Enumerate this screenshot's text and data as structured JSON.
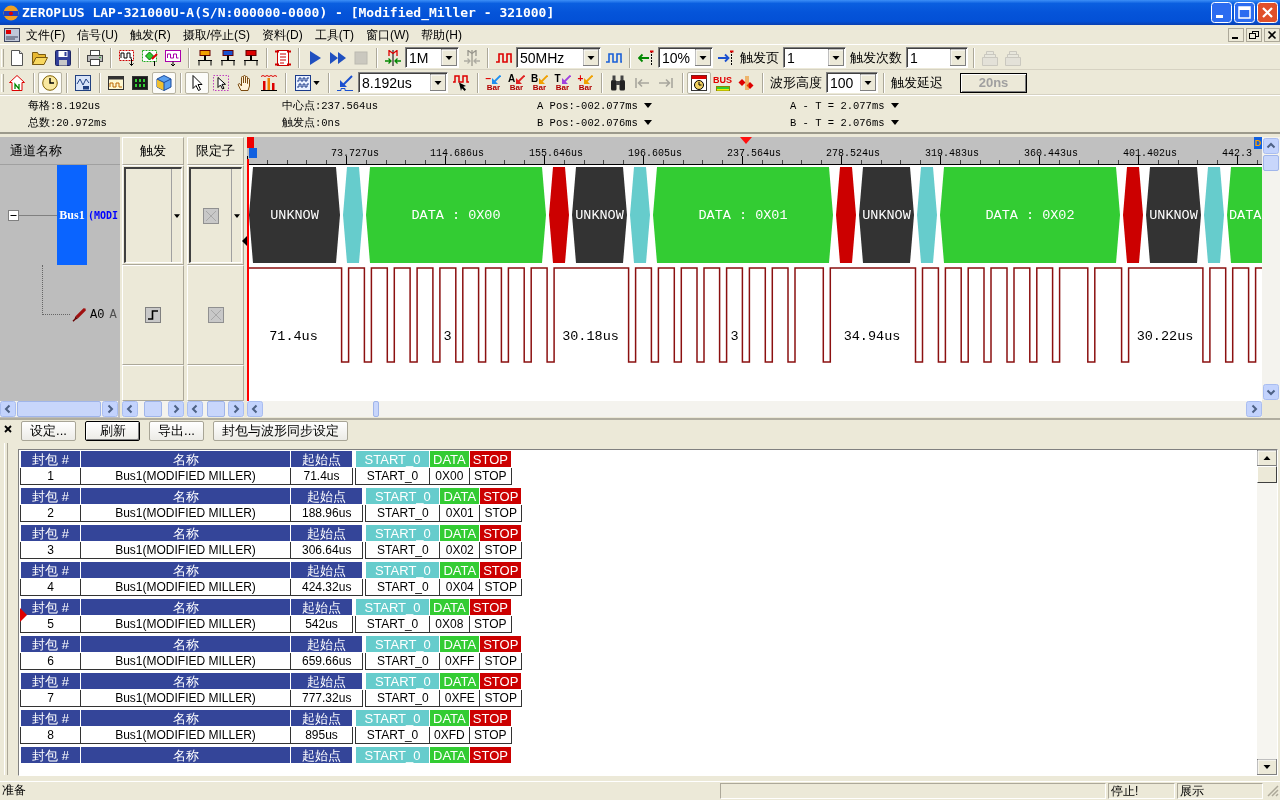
{
  "window": {
    "title": "ZEROPLUS LAP-321000U-A(S/N:000000-0000) - [Modified_Miller - 321000]"
  },
  "menu": [
    {
      "label": "文件(F)"
    },
    {
      "label": "信号(U)"
    },
    {
      "label": "触发(R)"
    },
    {
      "label": "摄取/停止(S)"
    },
    {
      "label": "资料(D)"
    },
    {
      "label": "工具(T)"
    },
    {
      "label": "窗口(W)"
    },
    {
      "label": "帮助(H)"
    }
  ],
  "toolbars": [
    {
      "groups": [
        [
          {
            "kind": "tool",
            "pressed": false,
            "disabled": false
          },
          {
            "kind": "tool",
            "pressed": false,
            "disabled": false
          },
          {
            "kind": "tool",
            "pressed": false,
            "disabled": false
          }
        ],
        [
          {
            "kind": "tool",
            "pressed": false,
            "disabled": false
          }
        ],
        [
          {
            "kind": "tool",
            "pressed": false,
            "disabled": false
          },
          {
            "kind": "tool",
            "pressed": false,
            "disabled": false
          },
          {
            "kind": "tool",
            "pressed": false,
            "disabled": false
          }
        ],
        [
          {
            "kind": "tool",
            "pressed": false,
            "disabled": false
          },
          {
            "kind": "tool",
            "pressed": false,
            "disabled": false
          },
          {
            "kind": "tool",
            "pressed": false,
            "disabled": false
          }
        ],
        [
          {
            "kind": "tool",
            "pressed": false,
            "disabled": false
          }
        ],
        [
          {
            "kind": "tool",
            "pressed": false,
            "disabled": false
          },
          {
            "kind": "tool",
            "pressed": false,
            "disabled": false
          },
          {
            "kind": "tool",
            "pressed": false,
            "disabled": true
          }
        ],
        [
          {
            "kind": "tool",
            "pressed": false,
            "disabled": false
          },
          {
            "kind": "combo",
            "value": "1M"
          },
          {
            "kind": "tool",
            "pressed": false,
            "disabled": true
          }
        ],
        [
          {
            "kind": "tool",
            "pressed": false,
            "disabled": false
          },
          {
            "kind": "combo",
            "value": "50MHz"
          },
          {
            "kind": "tool",
            "pressed": false,
            "disabled": false
          }
        ],
        [
          {
            "kind": "tool",
            "pressed": false,
            "disabled": false
          },
          {
            "kind": "combo",
            "value": "10%"
          },
          {
            "kind": "tool",
            "pressed": false,
            "disabled": false
          },
          {
            "kind": "label",
            "text": "触发页"
          },
          {
            "kind": "combo",
            "value": "1"
          },
          {
            "kind": "label",
            "text": "触发次数"
          },
          {
            "kind": "combo",
            "value": "1"
          }
        ],
        [
          {
            "kind": "tool",
            "pressed": false,
            "disabled": true
          },
          {
            "kind": "tool",
            "pressed": false,
            "disabled": true
          }
        ]
      ]
    },
    {
      "groups": [
        [
          {
            "kind": "tool",
            "pressed": false,
            "disabled": false
          }
        ],
        [
          {
            "kind": "tool",
            "pressed": true,
            "disabled": false
          }
        ],
        [
          {
            "kind": "tool",
            "pressed": false,
            "disabled": false
          }
        ],
        [
          {
            "kind": "tool",
            "pressed": false,
            "disabled": false
          },
          {
            "kind": "tool",
            "pressed": false,
            "disabled": false
          },
          {
            "kind": "tool",
            "pressed": true,
            "disabled": false
          }
        ],
        [
          {
            "kind": "tool",
            "pressed": true,
            "disabled": false
          },
          {
            "kind": "tool",
            "pressed": false,
            "disabled": false
          },
          {
            "kind": "tool",
            "pressed": false,
            "disabled": false
          },
          {
            "kind": "tool",
            "pressed": false,
            "disabled": false
          }
        ],
        [
          {
            "kind": "split-tool",
            "pressed": false,
            "disabled": false
          }
        ],
        [
          {
            "kind": "tool",
            "pressed": false,
            "disabled": false
          },
          {
            "kind": "combo",
            "value": "8.192us"
          },
          {
            "kind": "tool",
            "pressed": false,
            "disabled": false
          }
        ],
        [
          {
            "kind": "sign-tool",
            "glyph": "−",
            "caption": "Bar",
            "color": "#1e8ff0"
          },
          {
            "kind": "letter-tool",
            "glyph": "A",
            "caption": "Bar",
            "color": "#e02020"
          },
          {
            "kind": "letter-tool",
            "glyph": "B",
            "caption": "Bar",
            "color": "#f0a000"
          },
          {
            "kind": "letter-tool",
            "glyph": "T",
            "caption": "Bar",
            "color": "#a040e0"
          },
          {
            "kind": "sign-tool",
            "glyph": "+",
            "caption": "Bar",
            "color": "#f0a000"
          }
        ],
        [
          {
            "kind": "tool",
            "pressed": false,
            "disabled": false
          },
          {
            "kind": "tool",
            "pressed": false,
            "disabled": true
          },
          {
            "kind": "tool",
            "pressed": false,
            "disabled": true
          }
        ],
        [
          {
            "kind": "tool",
            "pressed": true,
            "disabled": false
          },
          {
            "kind": "bus-tool",
            "caption": "BUS"
          },
          {
            "kind": "tool",
            "pressed": false,
            "disabled": false
          }
        ],
        [
          {
            "kind": "label",
            "text": "波形高度"
          },
          {
            "kind": "combo",
            "value": "100"
          }
        ],
        [
          {
            "kind": "label",
            "text": "触发延迟"
          },
          {
            "kind": "button",
            "label": "20ns",
            "disabled": true
          }
        ]
      ]
    }
  ],
  "readouts": {
    "columns": [
      {
        "items": [
          {
            "kind": "text",
            "text": "每格:8.192us"
          },
          {
            "kind": "text",
            "text": "总数:20.972ms"
          }
        ]
      },
      {
        "items": [
          {
            "kind": "text",
            "text": "中心点:237.564us"
          },
          {
            "kind": "text",
            "text": "触发点:0ns"
          }
        ]
      },
      {
        "items": [
          {
            "kind": "menu",
            "text": "A Pos:-002.077ms"
          },
          {
            "kind": "menu",
            "text": "B Pos:-002.076ms"
          }
        ]
      },
      {
        "items": [
          {
            "kind": "menu",
            "text": "A - T = 2.077ms"
          },
          {
            "kind": "menu",
            "text": "B - T = 2.076ms"
          }
        ]
      }
    ]
  },
  "signals": {
    "headers": {
      "name": "通道名称",
      "trigger": "触发",
      "qualifier": "限定子"
    },
    "ruler": {
      "ticks": [
        "73.727us",
        "114.686us",
        "155.646us",
        "196.605us",
        "237.564us",
        "278.524us",
        "319.483us",
        "360.443us",
        "401.402us",
        "442.3"
      ],
      "end_marker": "D"
    },
    "bus": {
      "name": "Bus1",
      "protocol": "(MODI",
      "expanded": true,
      "qualifier": {
        "kind": "ignore"
      },
      "segments": [
        {
          "kind": "unknown",
          "label": "UNKNOW"
        },
        {
          "kind": "start"
        },
        {
          "kind": "data",
          "label": "DATA : 0X00"
        },
        {
          "kind": "stop"
        },
        {
          "kind": "unknown",
          "label": "UNKNOW"
        },
        {
          "kind": "start"
        },
        {
          "kind": "data",
          "label": "DATA : 0X01"
        },
        {
          "kind": "stop"
        },
        {
          "kind": "unknown",
          "label": "UNKNOW"
        },
        {
          "kind": "start"
        },
        {
          "kind": "data",
          "label": "DATA : 0X02"
        },
        {
          "kind": "stop"
        },
        {
          "kind": "unknown",
          "label": "UNKNOW"
        },
        {
          "kind": "start"
        },
        {
          "kind": "data",
          "label": "DATA"
        }
      ]
    },
    "channels": [
      {
        "name": "A0",
        "alias": "A",
        "trigger": {
          "kind": "rising"
        },
        "qualifier": {
          "kind": "ignore"
        },
        "readings": [
          "71.4us",
          "3",
          "30.18us",
          "3",
          "34.94us",
          "30.22us"
        ]
      }
    ]
  },
  "packet_panel": {
    "buttons": [
      {
        "label": "设定...",
        "default": false
      },
      {
        "label": "刷新",
        "default": true
      },
      {
        "label": "导出...",
        "default": false
      },
      {
        "label": "封包与波形同步设定",
        "default": false
      }
    ],
    "packets": [
      {
        "selected": false,
        "columns": [
          "封包 #",
          "名称",
          "起始点"
        ],
        "number": "1",
        "name": "Bus1(MODIFIED MILLER)",
        "start": "71.4us",
        "fields": [
          {
            "label": "START_0",
            "color": "#66cccc",
            "value": "START_0"
          },
          {
            "label": "DATA",
            "color": "#33cc33",
            "value": "0X00"
          },
          {
            "label": "STOP",
            "color": "#cc0000",
            "value": "STOP"
          }
        ]
      },
      {
        "selected": false,
        "columns": [
          "封包 #",
          "名称",
          "起始点"
        ],
        "number": "2",
        "name": "Bus1(MODIFIED MILLER)",
        "start": "188.96us",
        "fields": [
          {
            "label": "START_0",
            "color": "#66cccc",
            "value": "START_0"
          },
          {
            "label": "DATA",
            "color": "#33cc33",
            "value": "0X01"
          },
          {
            "label": "STOP",
            "color": "#cc0000",
            "value": "STOP"
          }
        ]
      },
      {
        "selected": false,
        "columns": [
          "封包 #",
          "名称",
          "起始点"
        ],
        "number": "3",
        "name": "Bus1(MODIFIED MILLER)",
        "start": "306.64us",
        "fields": [
          {
            "label": "START_0",
            "color": "#66cccc",
            "value": "START_0"
          },
          {
            "label": "DATA",
            "color": "#33cc33",
            "value": "0X02"
          },
          {
            "label": "STOP",
            "color": "#cc0000",
            "value": "STOP"
          }
        ]
      },
      {
        "selected": false,
        "columns": [
          "封包 #",
          "名称",
          "起始点"
        ],
        "number": "4",
        "name": "Bus1(MODIFIED MILLER)",
        "start": "424.32us",
        "fields": [
          {
            "label": "START_0",
            "color": "#66cccc",
            "value": "START_0"
          },
          {
            "label": "DATA",
            "color": "#33cc33",
            "value": "0X04"
          },
          {
            "label": "STOP",
            "color": "#cc0000",
            "value": "STOP"
          }
        ]
      },
      {
        "selected": true,
        "columns": [
          "封包 #",
          "名称",
          "起始点"
        ],
        "number": "5",
        "name": "Bus1(MODIFIED MILLER)",
        "start": "542us",
        "fields": [
          {
            "label": "START_0",
            "color": "#66cccc",
            "value": "START_0"
          },
          {
            "label": "DATA",
            "color": "#33cc33",
            "value": "0X08"
          },
          {
            "label": "STOP",
            "color": "#cc0000",
            "value": "STOP"
          }
        ]
      },
      {
        "selected": false,
        "columns": [
          "封包 #",
          "名称",
          "起始点"
        ],
        "number": "6",
        "name": "Bus1(MODIFIED MILLER)",
        "start": "659.66us",
        "fields": [
          {
            "label": "START_0",
            "color": "#66cccc",
            "value": "START_0"
          },
          {
            "label": "DATA",
            "color": "#33cc33",
            "value": "0XFF"
          },
          {
            "label": "STOP",
            "color": "#cc0000",
            "value": "STOP"
          }
        ]
      },
      {
        "selected": false,
        "columns": [
          "封包 #",
          "名称",
          "起始点"
        ],
        "number": "7",
        "name": "Bus1(MODIFIED MILLER)",
        "start": "777.32us",
        "fields": [
          {
            "label": "START_0",
            "color": "#66cccc",
            "value": "START_0"
          },
          {
            "label": "DATA",
            "color": "#33cc33",
            "value": "0XFE"
          },
          {
            "label": "STOP",
            "color": "#cc0000",
            "value": "STOP"
          }
        ]
      },
      {
        "selected": false,
        "columns": [
          "封包 #",
          "名称",
          "起始点"
        ],
        "number": "8",
        "name": "Bus1(MODIFIED MILLER)",
        "start": "895us",
        "fields": [
          {
            "label": "START_0",
            "color": "#66cccc",
            "value": "START_0"
          },
          {
            "label": "DATA",
            "color": "#33cc33",
            "value": "0XFD"
          },
          {
            "label": "STOP",
            "color": "#cc0000",
            "value": "STOP"
          }
        ]
      },
      {
        "selected": false,
        "columns": [
          "封包 #",
          "名称",
          "起始点"
        ],
        "fields": [
          {
            "label": "START_0",
            "color": "#66cccc"
          },
          {
            "label": "DATA",
            "color": "#33cc33"
          },
          {
            "label": "STOP",
            "color": "#cc0000"
          }
        ]
      }
    ]
  },
  "status_bar": {
    "message": "准备",
    "panels": [
      {
        "text": "停止!"
      },
      {
        "text": "展示"
      }
    ]
  }
}
